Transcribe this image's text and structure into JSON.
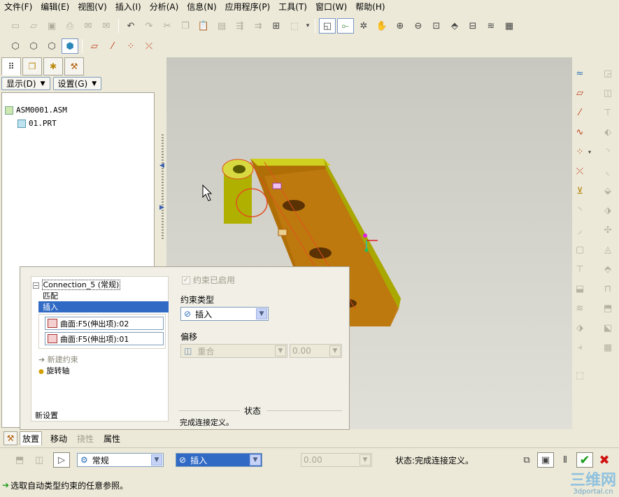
{
  "menubar": {
    "items": [
      "文件(F)",
      "编辑(E)",
      "视图(V)",
      "插入(I)",
      "分析(A)",
      "信息(N)",
      "应用程序(P)",
      "工具(T)",
      "窗口(W)",
      "帮助(H)"
    ]
  },
  "model_tree": {
    "show_label": "显示(D)",
    "settings_label": "设置(G)",
    "nodes": [
      {
        "label": "ASM0001.ASM"
      },
      {
        "label": "01.PRT"
      }
    ]
  },
  "dashboard": {
    "connection_title": "Connection_5 (常规)",
    "list_items": [
      "匹配",
      "插入"
    ],
    "references": [
      "曲面:F5(伸出项):02",
      "曲面:F5(伸出项):01"
    ],
    "new_constraint": "新建约束",
    "rotation_axis": "旋转轴",
    "new_set": "新设置",
    "constraint_enabled_label": "约束已启用",
    "constraint_type_label": "约束类型",
    "constraint_type_value": "插入",
    "offset_label": "偏移",
    "offset_value": "重合",
    "offset_number": "0.00",
    "status_section": "状态",
    "status_text": "完成连接定义。"
  },
  "dashboard_tabs": {
    "placement": "放置",
    "move": "移动",
    "flexibility": "挠性",
    "properties": "属性"
  },
  "bottom_bar": {
    "connection_type": "常规",
    "constraint_value": "插入",
    "offset_value": "0.00",
    "status_text": "状态:完成连接定义。"
  },
  "status_line": {
    "message": "选取自动类型约束的任意参照。"
  },
  "watermark": {
    "main": "三维网",
    "sub": "3dportal.cn"
  },
  "colors": {
    "selection": "#316ac5",
    "part_body": "#c8860a",
    "part_edge": "#c8c81e",
    "graphics_bg": "#d4d3cc"
  }
}
